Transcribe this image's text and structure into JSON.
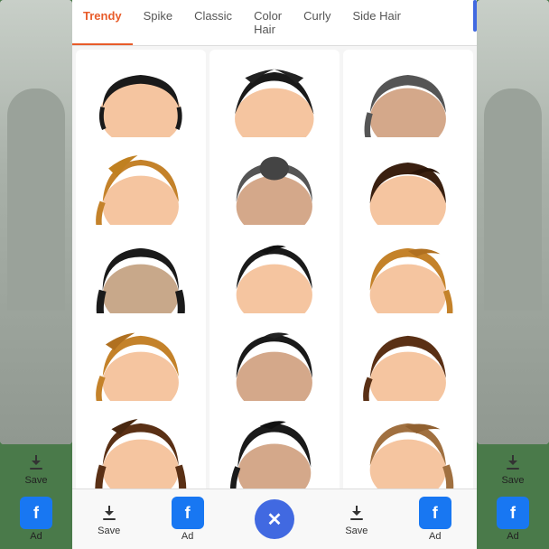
{
  "tabs": [
    {
      "label": "Trendy",
      "active": true
    },
    {
      "label": "Spike",
      "active": false
    },
    {
      "label": "Classic",
      "active": false
    },
    {
      "label": "Color Hair",
      "active": false
    },
    {
      "label": "Curly",
      "active": false
    },
    {
      "label": "Side Hair",
      "active": false
    }
  ],
  "bottom_bar": {
    "save_label": "Save",
    "ad_label": "Ad",
    "close_label": "✕"
  },
  "side_left": {
    "save_label": "Save",
    "ad_label": "Ad"
  },
  "side_right": {
    "save_label": "Save",
    "ad_label": "Ad"
  },
  "hair_styles": [
    {
      "id": 1,
      "color": "#1a1a1a",
      "style": "pompadour"
    },
    {
      "id": 2,
      "color": "#1a1a1a",
      "style": "wavy"
    },
    {
      "id": 3,
      "color": "#444",
      "style": "side"
    },
    {
      "id": 4,
      "color": "#c4822a",
      "style": "sweep"
    },
    {
      "id": 5,
      "color": "#555",
      "style": "bun"
    },
    {
      "id": 6,
      "color": "#3a2010",
      "style": "bun2"
    },
    {
      "id": 7,
      "color": "#1a1a1a",
      "style": "slick"
    },
    {
      "id": 8,
      "color": "#1a1a1a",
      "style": "quiff"
    },
    {
      "id": 9,
      "color": "#c4822a",
      "style": "messy"
    },
    {
      "id": 10,
      "color": "#c4822a",
      "style": "sweep2"
    },
    {
      "id": 11,
      "color": "#1a1a1a",
      "style": "textured"
    },
    {
      "id": 12,
      "color": "#5a3015",
      "style": "classic2"
    },
    {
      "id": 13,
      "color": "#5a3015",
      "style": "flow"
    },
    {
      "id": 14,
      "color": "#1a1a1a",
      "style": "undercut"
    },
    {
      "id": 15,
      "color": "#a07040",
      "style": "side2"
    }
  ]
}
